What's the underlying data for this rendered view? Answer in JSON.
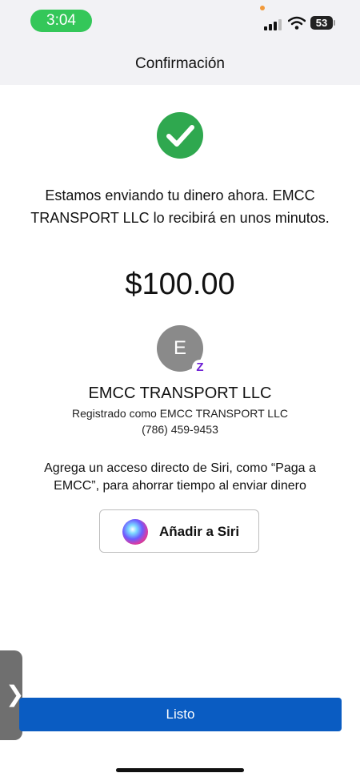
{
  "status_bar": {
    "time": "3:04",
    "battery": "53",
    "icons": [
      "signal-icon",
      "wifi-icon",
      "battery-icon"
    ]
  },
  "header": {
    "title": "Confirmación"
  },
  "confirmation": {
    "message": "Estamos enviando tu dinero ahora. EMCC TRANSPORT LLC lo recibirá en unos minutos.",
    "amount": "$100.00",
    "icon": "checkmark-icon"
  },
  "recipient": {
    "initial": "E",
    "badge": "Z",
    "name": "EMCC TRANSPORT LLC",
    "registered_as": "Registrado como EMCC TRANSPORT LLC",
    "phone": "(786) 459-9453"
  },
  "siri": {
    "prompt": "Agrega un acceso directo de Siri, como “Paga a EMCC”, para ahorrar tiempo al enviar dinero",
    "button_label": "Añadir a Siri"
  },
  "footer": {
    "done_label": "Listo"
  },
  "colors": {
    "success": "#2fa84f",
    "primary": "#0a5cc2",
    "zelle": "#6d1ed4",
    "status_pill": "#34c759"
  }
}
